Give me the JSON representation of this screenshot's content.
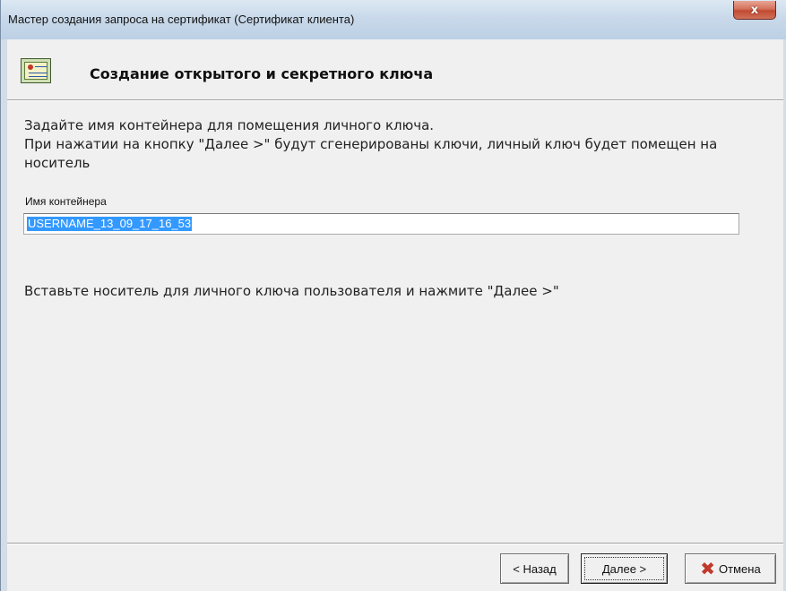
{
  "window": {
    "title": "Мастер создания запроса на сертификат (Сертификат клиента)",
    "close_glyph": "x"
  },
  "header": {
    "title": "Создание открытого и секретного ключа",
    "icon": "certificate-icon"
  },
  "content": {
    "instruction_line1": "Задайте имя контейнера для помещения личного ключа.",
    "instruction_line2": "При нажатии на кнопку \"Далее >\" будут сгенерированы ключи, личный ключ будет помещен на носитель",
    "container_label": "Имя контейнера",
    "container_value": "USERNAME_13_09_17_16_53",
    "insert_prompt": "Вставьте носитель для личного ключа пользователя и нажмите \"Далее >\""
  },
  "buttons": {
    "back": "< Назад",
    "next": "Далее >",
    "cancel": "Отмена",
    "cancel_icon": "✖"
  },
  "colors": {
    "selection": "#3399ff",
    "cancel_icon": "#c0392b",
    "close_button": "#c24a31"
  }
}
